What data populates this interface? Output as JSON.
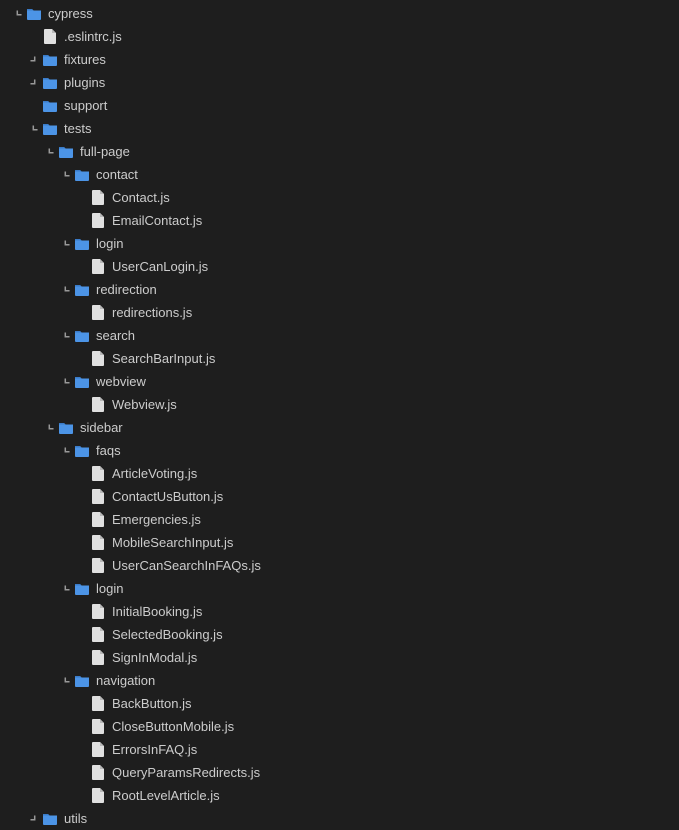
{
  "tree": [
    {
      "type": "folder",
      "name": "cypress",
      "depth": 0,
      "expanded": true
    },
    {
      "type": "file",
      "name": ".eslintrc.js",
      "depth": 1
    },
    {
      "type": "folder",
      "name": "fixtures",
      "depth": 1,
      "expanded": false
    },
    {
      "type": "folder",
      "name": "plugins",
      "depth": 1,
      "expanded": false
    },
    {
      "type": "folder",
      "name": "support",
      "depth": 1,
      "expanded": null
    },
    {
      "type": "folder",
      "name": "tests",
      "depth": 1,
      "expanded": true
    },
    {
      "type": "folder",
      "name": "full-page",
      "depth": 2,
      "expanded": true
    },
    {
      "type": "folder",
      "name": "contact",
      "depth": 3,
      "expanded": true
    },
    {
      "type": "file",
      "name": "Contact.js",
      "depth": 4
    },
    {
      "type": "file",
      "name": "EmailContact.js",
      "depth": 4
    },
    {
      "type": "folder",
      "name": "login",
      "depth": 3,
      "expanded": true
    },
    {
      "type": "file",
      "name": "UserCanLogin.js",
      "depth": 4
    },
    {
      "type": "folder",
      "name": "redirection",
      "depth": 3,
      "expanded": true
    },
    {
      "type": "file",
      "name": "redirections.js",
      "depth": 4
    },
    {
      "type": "folder",
      "name": "search",
      "depth": 3,
      "expanded": true
    },
    {
      "type": "file",
      "name": "SearchBarInput.js",
      "depth": 4
    },
    {
      "type": "folder",
      "name": "webview",
      "depth": 3,
      "expanded": true
    },
    {
      "type": "file",
      "name": "Webview.js",
      "depth": 4
    },
    {
      "type": "folder",
      "name": "sidebar",
      "depth": 2,
      "expanded": true
    },
    {
      "type": "folder",
      "name": "faqs",
      "depth": 3,
      "expanded": true
    },
    {
      "type": "file",
      "name": "ArticleVoting.js",
      "depth": 4
    },
    {
      "type": "file",
      "name": "ContactUsButton.js",
      "depth": 4
    },
    {
      "type": "file",
      "name": "Emergencies.js",
      "depth": 4
    },
    {
      "type": "file",
      "name": "MobileSearchInput.js",
      "depth": 4
    },
    {
      "type": "file",
      "name": "UserCanSearchInFAQs.js",
      "depth": 4
    },
    {
      "type": "folder",
      "name": "login",
      "depth": 3,
      "expanded": true
    },
    {
      "type": "file",
      "name": "InitialBooking.js",
      "depth": 4
    },
    {
      "type": "file",
      "name": "SelectedBooking.js",
      "depth": 4
    },
    {
      "type": "file",
      "name": "SignInModal.js",
      "depth": 4
    },
    {
      "type": "folder",
      "name": "navigation",
      "depth": 3,
      "expanded": true
    },
    {
      "type": "file",
      "name": "BackButton.js",
      "depth": 4
    },
    {
      "type": "file",
      "name": "CloseButtonMobile.js",
      "depth": 4
    },
    {
      "type": "file",
      "name": "ErrorsInFAQ.js",
      "depth": 4
    },
    {
      "type": "file",
      "name": "QueryParamsRedirects.js",
      "depth": 4
    },
    {
      "type": "file",
      "name": "RootLevelArticle.js",
      "depth": 4
    },
    {
      "type": "folder",
      "name": "utils",
      "depth": 1,
      "expanded": false
    }
  ],
  "colors": {
    "folder": "#4c94e6",
    "file": "#e0e0e0",
    "chevron": "#999999"
  }
}
